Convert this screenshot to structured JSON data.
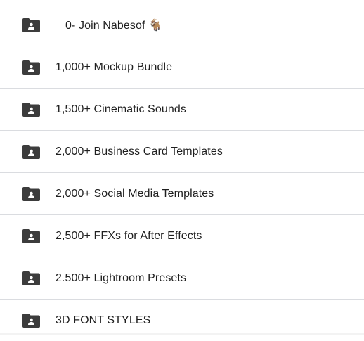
{
  "folders": [
    {
      "name": "0- Join Nabesof 🐐",
      "icon": "shared-folder-icon"
    },
    {
      "name": "1,000+ Mockup Bundle",
      "icon": "shared-folder-icon"
    },
    {
      "name": "1,500+ Cinematic Sounds",
      "icon": "shared-folder-icon"
    },
    {
      "name": "2,000+ Business Card Templates",
      "icon": "shared-folder-icon"
    },
    {
      "name": "2,000+ Social Media Templates",
      "icon": "shared-folder-icon"
    },
    {
      "name": "2,500+ FFXs for After Effects",
      "icon": "shared-folder-icon"
    },
    {
      "name": "2.500+ Lightroom Presets",
      "icon": "shared-folder-icon"
    },
    {
      "name": "3D FONT STYLES",
      "icon": "shared-folder-icon"
    }
  ],
  "colors": {
    "icon": "#3c3c3c",
    "divider": "#dadce0",
    "text": "#1f1f1f"
  }
}
